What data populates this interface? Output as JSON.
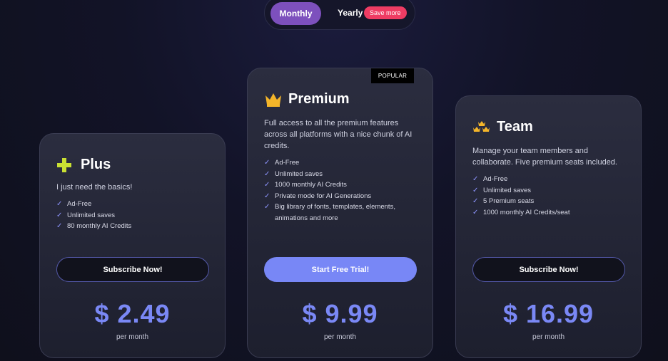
{
  "billing_toggle": {
    "monthly_label": "Monthly",
    "yearly_label": "Yearly",
    "save_badge": "Save more"
  },
  "plans": [
    {
      "name": "Plus",
      "icon": "plus-icon",
      "description": "I just need the basics!",
      "features": [
        "Ad-Free",
        "Unlimited saves",
        "80 monthly AI Credits"
      ],
      "button": "Subscribe Now!",
      "price": "$ 2.49",
      "period": "per month"
    },
    {
      "name": "Premium",
      "icon": "crown-icon",
      "badge": "POPULAR",
      "description": "Full access to all the premium features across all platforms with a nice chunk of AI credits.",
      "features": [
        "Ad-Free",
        "Unlimited saves",
        "1000 monthly AI Credits",
        "Private mode for AI Generations",
        "Big library of fonts, templates, elements, animations and more"
      ],
      "button": "Start Free Trial!",
      "price": "$ 9.99",
      "period": "per month"
    },
    {
      "name": "Team",
      "icon": "crowns-icon",
      "description": "Manage your team members and collaborate. Five premium seats included.",
      "features": [
        "Ad-Free",
        "Unlimited saves",
        "5 Premium seats",
        "1000 monthly AI Credits/seat"
      ],
      "button": "Subscribe Now!",
      "price": "$ 16.99",
      "period": "per month"
    }
  ],
  "colors": {
    "accent": "#7a88f5",
    "toggle_active": "#7d50bd",
    "save_badge": "#ef3c63",
    "icon_plus": "#c9e033",
    "icon_crown": "#f4b52a"
  }
}
